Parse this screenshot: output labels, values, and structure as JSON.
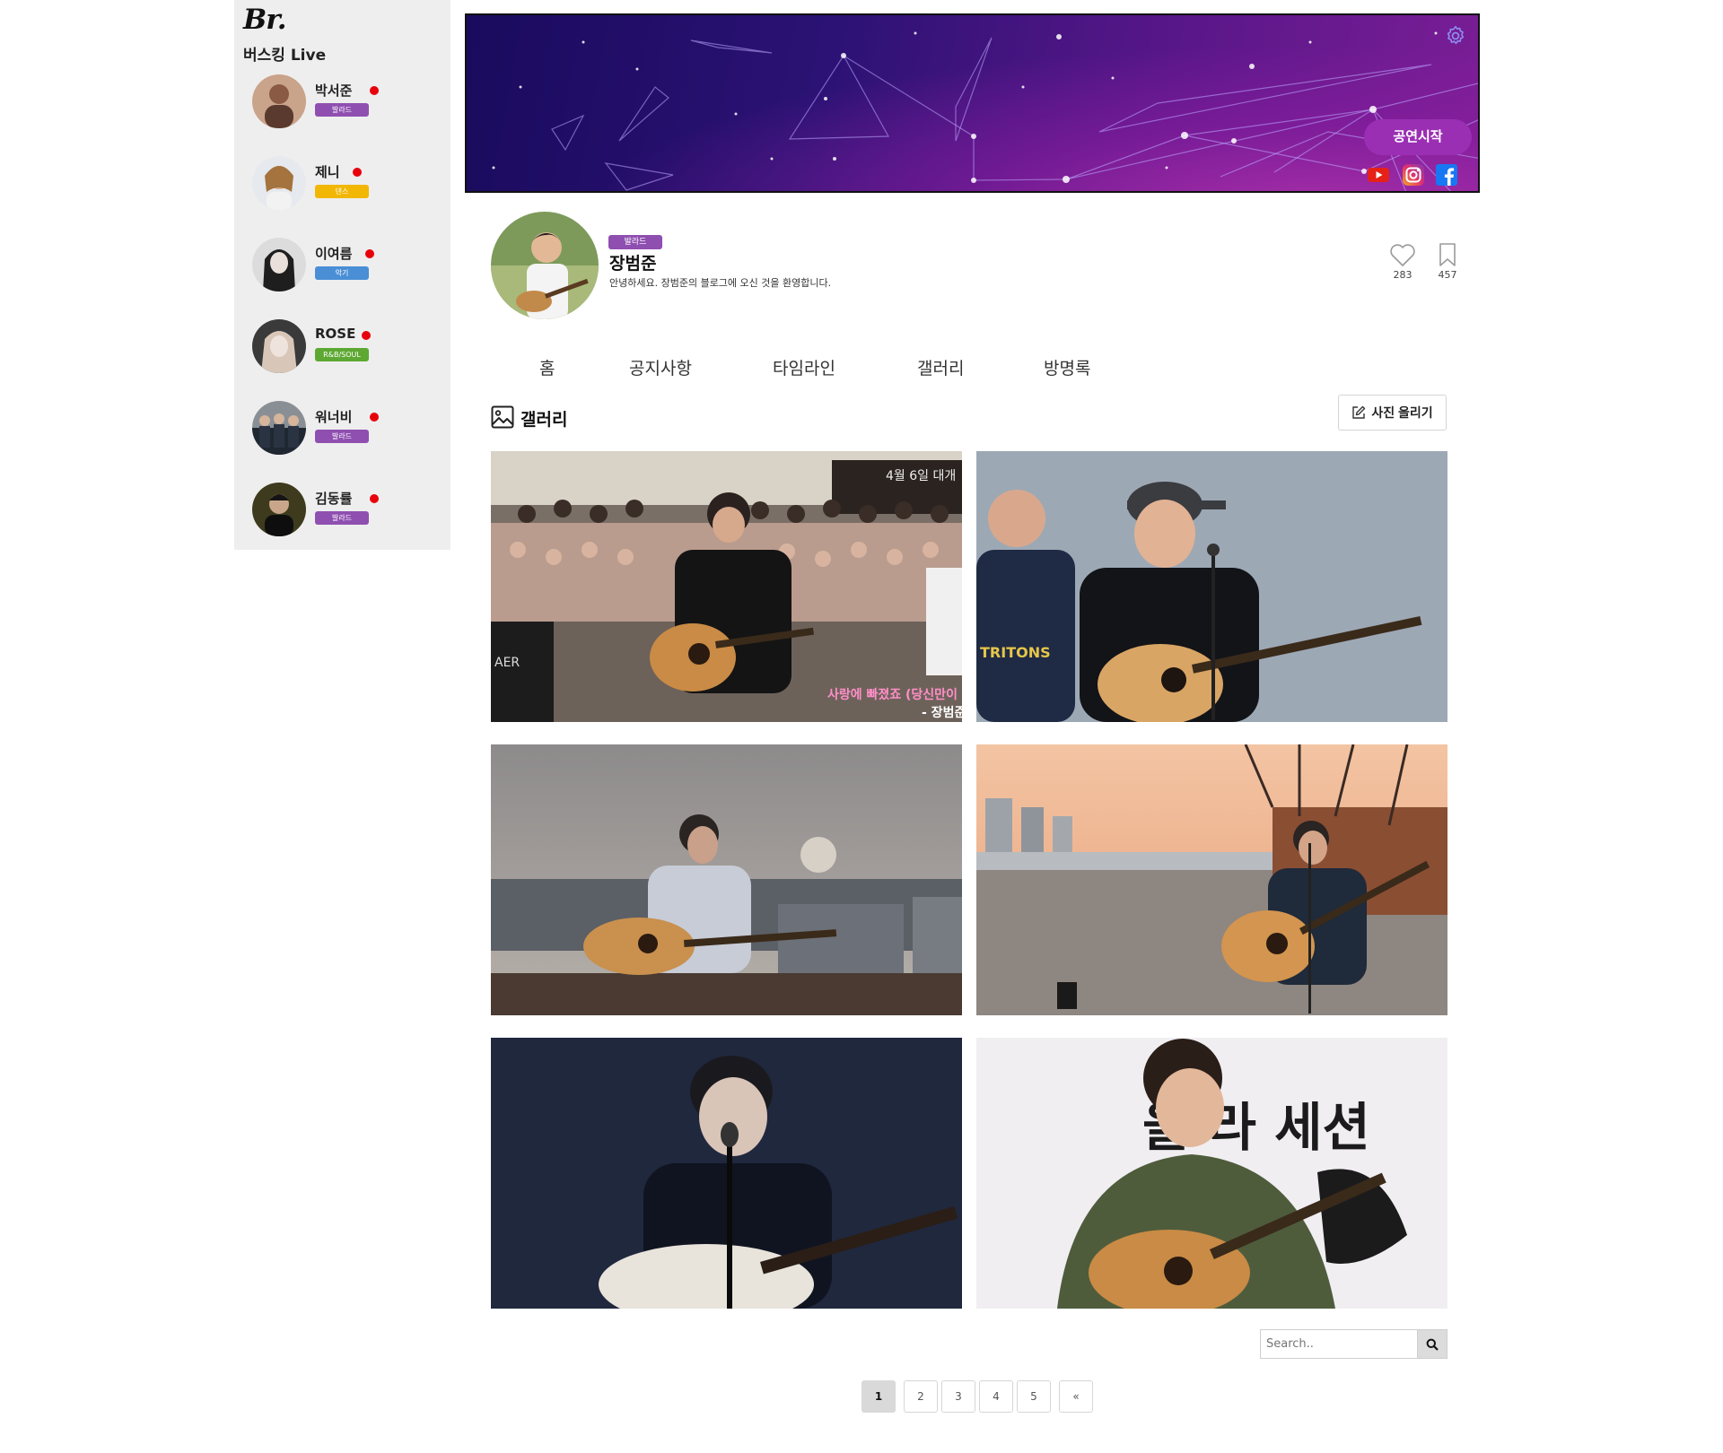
{
  "brand": {
    "logo": "Br.",
    "subtitle": "버스킹 Live"
  },
  "live_list": [
    {
      "name": "박서준",
      "tag": "발라드",
      "tag_color": "#8f4fb0"
    },
    {
      "name": "제니",
      "tag": "댄스",
      "tag_color": "#f2b705"
    },
    {
      "name": "이여름",
      "tag": "악기",
      "tag_color": "#4a8fd6"
    },
    {
      "name": "ROSE",
      "tag": "R&B/SOUL",
      "tag_color": "#5da832"
    },
    {
      "name": "워너비",
      "tag": "발라드",
      "tag_color": "#8f4fb0"
    },
    {
      "name": "김동률",
      "tag": "발라드",
      "tag_color": "#8f4fb0"
    }
  ],
  "live_indicator_color": "#e8000b",
  "banner": {
    "start_label": "공연시작",
    "accent": "#9b2fb4"
  },
  "social": [
    "youtube-icon",
    "instagram-icon",
    "facebook-icon"
  ],
  "profile": {
    "genre": "발라드",
    "name": "장범준",
    "description": "안녕하세요. 장범준의 블로그에 오신 것을 환영합니다.",
    "likes": "283",
    "bookmarks": "457"
  },
  "tabs": [
    "홈",
    "공지사항",
    "타임라인",
    "갤러리",
    "방명록"
  ],
  "gallery": {
    "title": "갤러리",
    "upload_label": "사진 올리기",
    "photo1_caption_date": "4월 6일 대개",
    "photo1_caption_song": "사랑에 빠졌죠 (당신만이",
    "photo1_caption_artist": "- 장범준",
    "photo1_brand_text": "AER",
    "photo2_shirt_text": "TRITONS",
    "photo6_banner_text": "울 라 세션"
  },
  "search": {
    "placeholder": "Search.."
  },
  "pagination": {
    "pages": [
      "1",
      "2",
      "3",
      "4",
      "5",
      "«"
    ],
    "current": "1"
  }
}
